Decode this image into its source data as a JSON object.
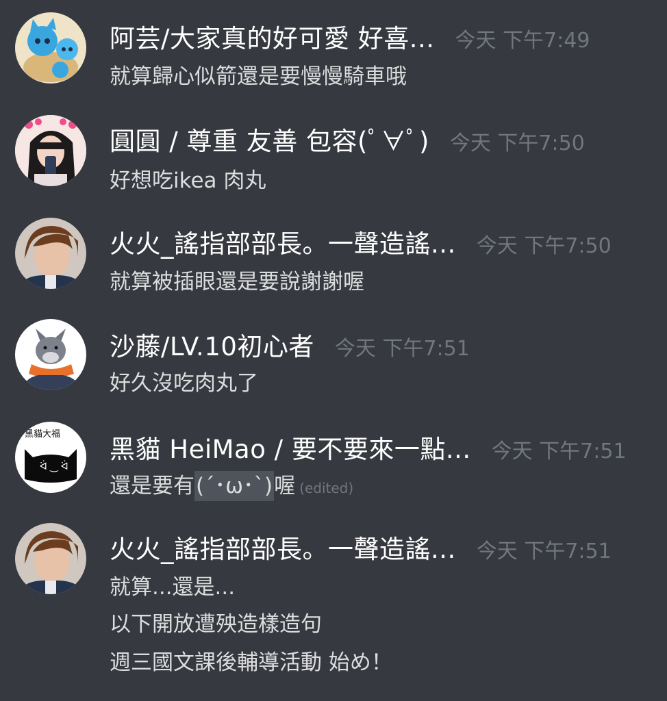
{
  "messages": [
    {
      "avatar_icon": "blue-cat-plush-avatar-icon",
      "username": "阿芸/大家真的好可愛 好喜...",
      "time": "今天 下午7:49",
      "lines": [
        "就算歸心似箭還是要慢慢騎車哦"
      ]
    },
    {
      "avatar_icon": "girl-selfie-avatar-icon",
      "username": "圓圓 / 尊重 友善 包容(ﾟ∀ﾟ)",
      "time": "今天 下午7:50",
      "lines": [
        "好想吃ikea 肉丸"
      ]
    },
    {
      "avatar_icon": "person-photo-avatar-icon",
      "username": "火火_謠指部部長。一聲造謠...",
      "time": "今天 下午7:50",
      "lines": [
        "就算被插眼還是要說謝謝喔"
      ]
    },
    {
      "avatar_icon": "wolf-scarf-avatar-icon",
      "username": "沙藤/LV.10初心者",
      "time": "今天 下午7:51",
      "lines": [
        "好久沒吃肉丸了"
      ]
    },
    {
      "avatar_icon": "black-cat-avatar-icon",
      "avatar_text": "黑貓大福",
      "username": "黑貓 HeiMao / 要不要來一點...",
      "time": "今天 下午7:51",
      "line_prefix": "還是要有",
      "emote": "(´･ω･`)",
      "line_suffix": "喔",
      "edited": "(edited)"
    },
    {
      "avatar_icon": "person-photo-avatar-icon",
      "username": "火火_謠指部部長。一聲造謠...",
      "time": "今天 下午7:51",
      "lines": [
        "就算...還是...",
        "以下開放遭殃造樣造句",
        "週三國文課後輔導活動 始め！"
      ]
    }
  ]
}
